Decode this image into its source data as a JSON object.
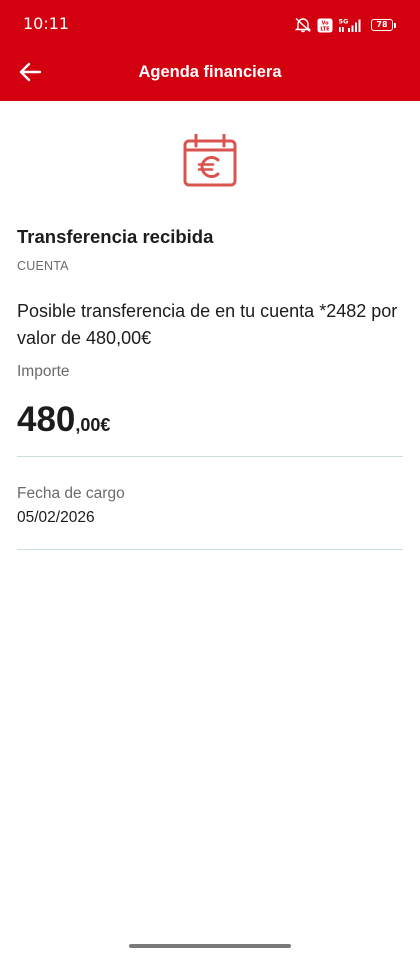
{
  "status_bar": {
    "time": "10:11",
    "battery": "78",
    "network": "5G",
    "volte": "Vo LTE",
    "icons": [
      "mute-icon",
      "volte-icon",
      "signal-icon",
      "battery-icon"
    ]
  },
  "header": {
    "title": "Agenda financiera",
    "back_icon": "arrow-left-icon",
    "background_color": "#d3000f"
  },
  "detail": {
    "icon": "calendar-euro-icon",
    "icon_color": "#d9534f",
    "title": "Transferencia recibida",
    "subtitle": "CUENTA",
    "description": "Posible transferencia de  en tu cuenta *2482 por valor de 480,00€",
    "amount_label": "Importe",
    "amount_integer": "480",
    "amount_decimal": ",00€",
    "date_label": "Fecha de cargo",
    "date_value": "05/02/2026"
  }
}
